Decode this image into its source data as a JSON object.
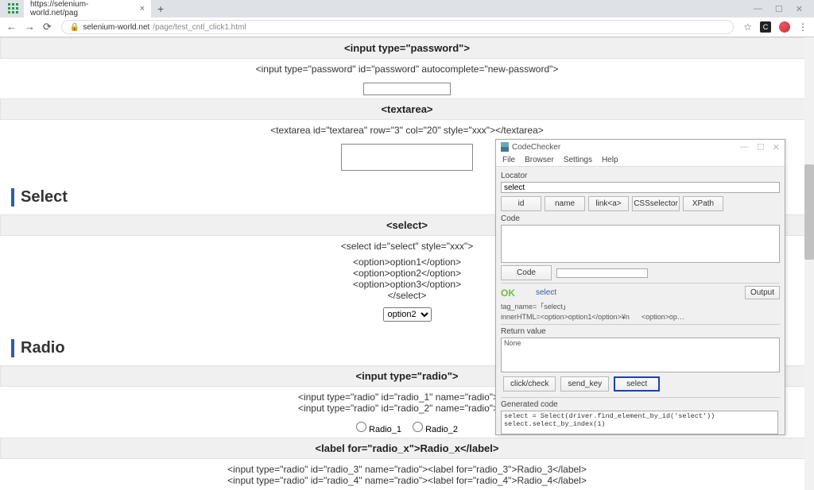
{
  "browser": {
    "tab_title": "https://selenium-world.net/pag",
    "url_domain": "selenium-world.net",
    "url_path": "/page/test_cntl_click1.html"
  },
  "page": {
    "password": {
      "header": "<input type=\"password\">",
      "code": "<input type=\"password\" id=\"password\" autocomplete=\"new-password\">"
    },
    "textarea": {
      "header": "<textarea>",
      "code": "<textarea id=\"textarea\" row=\"3\" col=\"20\" style=\"xxx\"></textarea>"
    },
    "select": {
      "title": "Select",
      "header": "<select>",
      "code": [
        "<select id=\"select\" style=\"xxx\">",
        "<option>option1</option>",
        "<option>option2</option>",
        "<option>option3</option>",
        "</select>"
      ],
      "value": "option2"
    },
    "radio": {
      "title": "Radio",
      "header": "<input type=\"radio\">",
      "code1": "<input type=\"radio\" id=\"radio_1\" name=\"radio\">Rad",
      "code2": "<input type=\"radio\" id=\"radio_2\" name=\"radio\">Rad",
      "label1": "Radio_1",
      "label2": "Radio_2",
      "band2": "<label for=\"radio_x\">Radio_x</label>",
      "code3": "<input type=\"radio\" id=\"radio_3\" name=\"radio\"><label for=\"radio_3\">Radio_3</label>",
      "code4": "<input type=\"radio\" id=\"radio_4\" name=\"radio\"><label for=\"radio_4\">Radio_4</label>"
    }
  },
  "cc": {
    "title": "CodeChecker",
    "menu": [
      "File",
      "Browser",
      "Settings",
      "Help"
    ],
    "locator_label": "Locator",
    "locator_value": "select",
    "buttons": [
      "id",
      "name",
      "link<a>",
      "CSSselector",
      "XPath"
    ],
    "code_label": "Code",
    "code_btn": "Code",
    "ok": "OK",
    "ok_sel": "select",
    "output": "Output",
    "tag_line": "tag_name=「select」",
    "inner_line1": "innerHTML=<option>option1</option>¥n",
    "inner_line2": "<option>op…",
    "ret_label": "Return value",
    "ret_value": "None",
    "actions": [
      "click/check",
      "send_key",
      "select"
    ],
    "gen_label": "Generated code",
    "gen_code": "select = Select(driver.find_element_by_id('select'))\nselect.select_by_index(1)"
  }
}
